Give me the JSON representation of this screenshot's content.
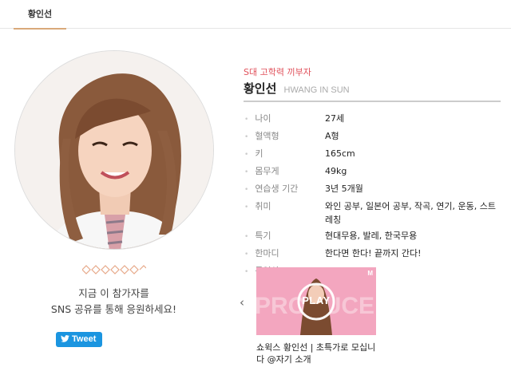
{
  "tabs": [
    {
      "label": "황인선",
      "active": true
    }
  ],
  "profile": {
    "tagline": "S대 고학력 끼부자",
    "name_kr": "황인선",
    "name_en": "HWANG IN SUN",
    "info": [
      {
        "label": "나이",
        "value": "27세"
      },
      {
        "label": "혈액형",
        "value": "A형"
      },
      {
        "label": "키",
        "value": "165cm"
      },
      {
        "label": "몸무게",
        "value": "49kg"
      },
      {
        "label": "연습생 기간",
        "value": "3년 5개월"
      },
      {
        "label": "취미",
        "value": "와인 공부, 일본어 공부, 작곡, 연기, 운동, 스트레칭"
      },
      {
        "label": "특기",
        "value": "현대무용, 발레, 한국무용"
      },
      {
        "label": "한마디",
        "value": "한다면 한다! 끝까지 간다!"
      },
      {
        "label": "동영상",
        "value": ""
      }
    ]
  },
  "support": {
    "line1": "지금 이 참가자를",
    "line2": "SNS 공유를 통해 응원하세요!",
    "tweet_label": "Tweet"
  },
  "video": {
    "play_label": "PLAY",
    "brand": "M",
    "title": "쇼윅스 황인선 | 초특가로 모십니다 @자기 소개",
    "prev_glyph": "‹"
  },
  "colors": {
    "accent_red": "#e0505a",
    "tab_underline": "#d9a97a",
    "twitter_blue": "#1b95e0",
    "thumb_pink": "#f3a6bf"
  },
  "icons": [
    "diamond-row-decoration",
    "twitter-bird-icon",
    "chevron-left-icon",
    "play-ring-icon"
  ]
}
